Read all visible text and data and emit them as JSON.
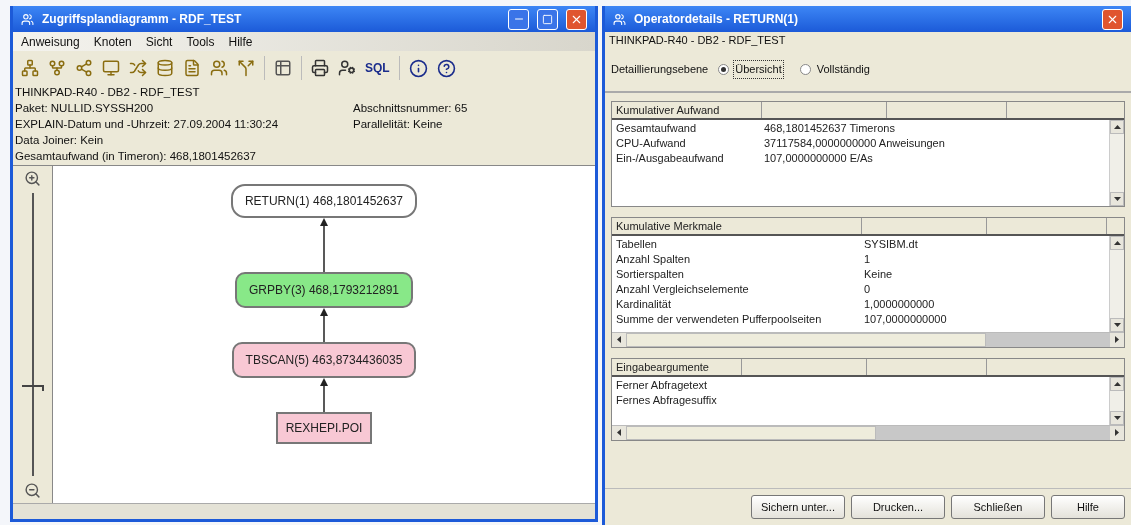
{
  "plan_window": {
    "title": "Zugriffsplandiagramm - RDF_TEST",
    "menu": [
      "Anweisung",
      "Knoten",
      "Sicht",
      "Tools",
      "Hilfe"
    ],
    "toolbar": {
      "sql_label": "SQL"
    },
    "info": [
      {
        "left": "THINKPAD-R40 - DB2 - RDF_TEST"
      },
      {
        "left": "Paket: NULLID.SYSSH200",
        "right": "Abschnittsnummer: 65"
      },
      {
        "left": "EXPLAIN-Datum und -Uhrzeit: 27.09.2004 11:30:24",
        "right": "Parallelität: Keine"
      },
      {
        "left": "Data Joiner: Kein"
      },
      {
        "left": "Gesamtaufwand (in Timeron): 468,1801452637"
      }
    ],
    "zoom_slider": {
      "level": 0.3
    },
    "nodes": [
      {
        "label": "RETURN(1) 468,1801452637",
        "kind": "rounded",
        "color": "#ffffff"
      },
      {
        "label": "GRPBY(3) 468,1793212891",
        "kind": "octagon",
        "color": "#88e888"
      },
      {
        "label": "TBSCAN(5) 463,8734436035",
        "kind": "octagon",
        "color": "#f8c8d4"
      },
      {
        "label": "REXHEPI.POI",
        "kind": "rect",
        "color": "#f8c8d4"
      }
    ]
  },
  "details_window": {
    "title": "Operatordetails - RETURN(1)",
    "subtitle": "THINKPAD-R40 - DB2 - RDF_TEST",
    "detail_label": "Detaillierungsebene",
    "detail_levels": [
      {
        "label": "Übersicht",
        "selected": true
      },
      {
        "label": "Vollständig",
        "selected": false
      }
    ],
    "sections": [
      {
        "heading": "Kumulativer Aufwand",
        "rows": [
          [
            "Gesamtaufwand",
            "468,1801452637 Timerons"
          ],
          [
            "CPU-Aufwand",
            "37117584,0000000000 Anweisungen"
          ],
          [
            "Ein-/Ausgabeaufwand",
            "107,0000000000 E/As"
          ]
        ]
      },
      {
        "heading": "Kumulative Merkmale",
        "rows": [
          [
            "Tabellen",
            "SYSIBM.dt"
          ],
          [
            "Anzahl Spalten",
            "1"
          ],
          [
            "Sortierspalten",
            "Keine"
          ],
          [
            "Anzahl Vergleichselemente",
            "0"
          ],
          [
            "Kardinalität",
            "1,0000000000"
          ],
          [
            "Summe der verwendeten Pufferpoolseiten",
            "107,0000000000"
          ]
        ]
      },
      {
        "heading": "Eingabeargumente",
        "rows": [
          [
            "Ferner Abfragetext"
          ],
          [
            "Fernes Abfragesuffix"
          ]
        ]
      }
    ],
    "buttons": [
      "Sichern unter...",
      "Drucken...",
      "Schließen",
      "Hilfe"
    ]
  }
}
